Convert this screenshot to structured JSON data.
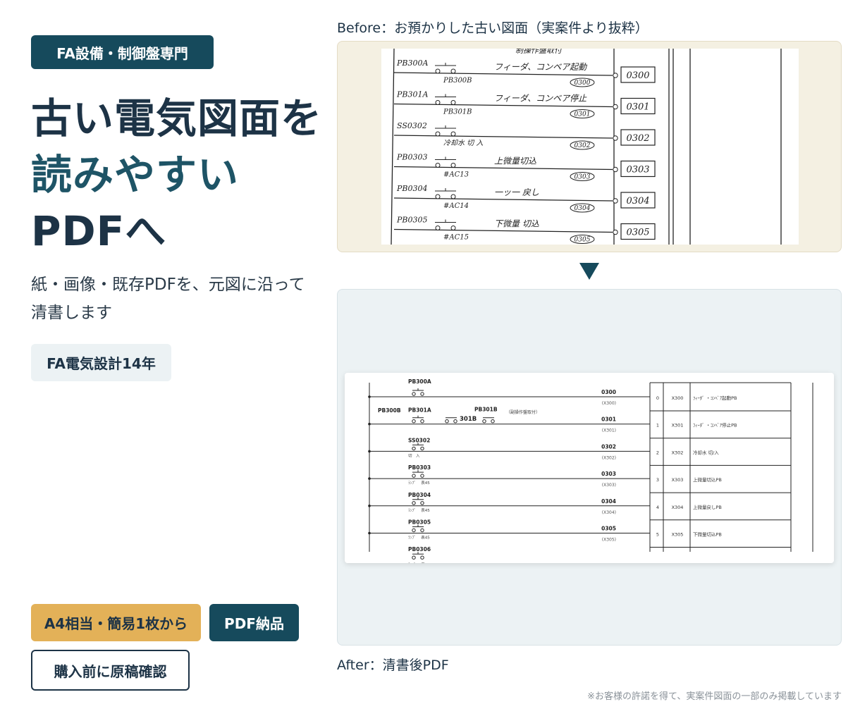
{
  "tags": {
    "category": "FA設備・制御盤専門",
    "experience": "FA電気設計14年"
  },
  "headline": {
    "line1": "古い電気図面を",
    "line2": "読みやすい",
    "line3": "PDFへ"
  },
  "subtext": "紙・画像・既存PDFを、元図に沿って清書します",
  "buttons": {
    "size": "A4相当・簡易1枚から",
    "delivery": "PDF納品",
    "check": "購入前に原稿確認"
  },
  "before": {
    "label": "Before：お預かりした古い図面（実案件より抜粋）",
    "header_note": "制操作盤取付",
    "rows": [
      {
        "contacts": "PB300A",
        "sub_contact": "PB300B",
        "desc": "フィーダ、コンベア起動",
        "circle": "0300",
        "box": "0300"
      },
      {
        "contacts": "PB301A",
        "sub_contact": "PB301B",
        "desc": "フィーダ、コンベア停止",
        "circle": "0301",
        "box": "0301"
      },
      {
        "contacts": "SS0302",
        "sub_contact": "冷却水 切 入",
        "desc": "",
        "circle": "0302",
        "box": "0302"
      },
      {
        "contacts": "PB0303",
        "sub_contact": "#AC13",
        "desc": "上微量切込",
        "circle": "0303",
        "box": "0303"
      },
      {
        "contacts": "PB0304",
        "sub_contact": "#AC14",
        "desc": "一ッ一 戻し",
        "circle": "0304",
        "box": "0304"
      },
      {
        "contacts": "PB0305",
        "sub_contact": "#AC15",
        "desc": "下微量 切込",
        "circle": "0305",
        "box": "0305"
      }
    ]
  },
  "after": {
    "label": "After：清書後PDF",
    "header_note": "（副操作盤取付）",
    "mid_label": "301B",
    "rows": [
      {
        "contact": "PB300A",
        "extra": "PB300B",
        "coil": "0300",
        "coil_sub": "(X300)",
        "idx": "0",
        "addr": "X300",
        "desc": "ﾌｨｰﾀﾞ ・ｺﾝﾍﾞｱ起動PB"
      },
      {
        "contact": "PB301A",
        "extra": "PB301B",
        "coil": "0301",
        "coil_sub": "(X301)",
        "idx": "1",
        "addr": "X301",
        "desc": "ﾌｨｰﾀﾞ ・ｺﾝﾍﾞｱ停止PB"
      },
      {
        "contact": "SS0302",
        "extra": "切　入",
        "coil": "0302",
        "coil_sub": "(X302)",
        "idx": "2",
        "addr": "X302",
        "desc": "冷却水 切/入"
      },
      {
        "contact": "PB0303",
        "extra": "ﾗﾝﾌﾟ 　表45",
        "coil": "0303",
        "coil_sub": "(X303)",
        "idx": "3",
        "addr": "X303",
        "desc": "上微量切込PB"
      },
      {
        "contact": "PB0304",
        "extra": "ﾗﾝﾌﾟ 　表45",
        "coil": "0304",
        "coil_sub": "(X304)",
        "idx": "4",
        "addr": "X304",
        "desc": "上微量戻しPB"
      },
      {
        "contact": "PB0305",
        "extra": "ﾗﾝﾌﾟ 　表45",
        "coil": "0305",
        "coil_sub": "(X305)",
        "idx": "5",
        "addr": "X305",
        "desc": "下微量切込PB"
      },
      {
        "contact": "PB0306",
        "extra": "ﾗﾝﾌﾟ 　表45",
        "coil": "",
        "coil_sub": "",
        "idx": "",
        "addr": "",
        "desc": ""
      }
    ]
  },
  "footnote": "※お客様の許諾を得て、実案件図面の一部のみ掲載しています"
}
